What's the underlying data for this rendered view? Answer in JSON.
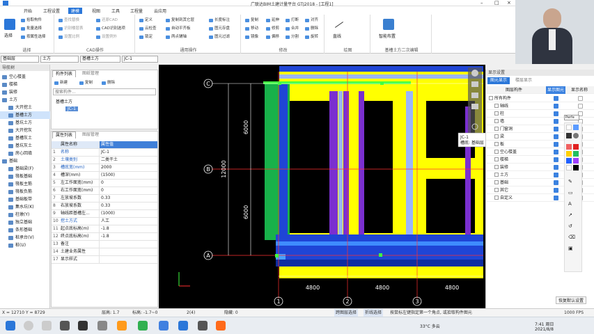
{
  "window": {
    "title": "广联达BIM土建计量平台 GTJ2018 - [工程1]"
  },
  "tabs": [
    "开始",
    "工程设置",
    "建模",
    "视图",
    "工具",
    "工程量",
    "云应用"
  ],
  "active_tab": "建模",
  "ribbon": {
    "select_group": {
      "label": "选择",
      "big": "选择",
      "items": [
        "拾取构件",
        "批量选择",
        "按属性选择"
      ]
    },
    "cad_group": {
      "label": "CAD操作",
      "items": [
        "查找替换",
        "识别楼层表",
        "CAD识别选项",
        "设置比例",
        "还原CAD",
        "设置例外"
      ]
    },
    "common_group": {
      "label": "通用操作",
      "items": [
        "定义",
        "云检查",
        "锁定",
        "复制到其它层",
        "自动平齐板",
        "两点辅轴",
        "长度标注",
        "图元存盘",
        "图元过滤"
      ]
    },
    "modify_group": {
      "label": "修改",
      "items": [
        "复制",
        "移动",
        "镜像",
        "延伸",
        "修剪",
        "偏移",
        "打断",
        "合并",
        "分割",
        "对齐",
        "删除",
        "旋转"
      ]
    },
    "draw_group": {
      "label": "绘图",
      "items": [
        "直线"
      ]
    },
    "smart_group": {
      "label": "基槽土方二次编辑",
      "items": [
        "智能布置"
      ]
    }
  },
  "selectors": [
    "基础层",
    "土方",
    "基槽土方",
    "JC-1"
  ],
  "nav": {
    "title": "导航树",
    "items": [
      "空心楼盖",
      "楼梯",
      "装修",
      "土方",
      "大开挖土",
      "基槽土方",
      "基坑土方",
      "大开挖灰",
      "基槽灰土",
      "基坑灰土",
      "房心回填",
      "基础",
      "基础梁(F)",
      "筏板基础",
      "筏板主筋",
      "筏板负筋",
      "基础板带",
      "集水坑(K)",
      "柱墩(Y)",
      "独立基础",
      "条形基础",
      "桩承台(V)",
      "桩(U)"
    ]
  },
  "component_list": {
    "tabs": [
      "构件列表",
      "图纸管理"
    ],
    "buttons": [
      "新建",
      "复制",
      "删除"
    ],
    "search_placeholder": "搜索构件...",
    "tree_root": "基槽土方",
    "tree_child": "JC-1"
  },
  "properties": {
    "tabs": [
      "属性列表",
      "图层管理"
    ],
    "headers": [
      "属性名称",
      "属性值"
    ],
    "rows": [
      {
        "n": "1",
        "k": "名称",
        "v": "JC-1"
      },
      {
        "n": "2",
        "k": "土壤类别",
        "v": "二类干土"
      },
      {
        "n": "3",
        "k": "槽底宽(mm)",
        "v": "2000"
      },
      {
        "n": "4",
        "k": "槽深(mm)",
        "v": "(1500)"
      },
      {
        "n": "5",
        "k": "左工作面宽(mm)",
        "v": "0"
      },
      {
        "n": "6",
        "k": "右工作面宽(mm)",
        "v": "0"
      },
      {
        "n": "7",
        "k": "左放坡系数",
        "v": "0.33"
      },
      {
        "n": "8",
        "k": "右放坡系数",
        "v": "0.33"
      },
      {
        "n": "9",
        "k": "轴线距基槽左...",
        "v": "(1000)"
      },
      {
        "n": "10",
        "k": "挖土方式",
        "v": "人工"
      },
      {
        "n": "11",
        "k": "起点底标高(m)",
        "v": "-1.8"
      },
      {
        "n": "12",
        "k": "终点底标高(m)",
        "v": "-1.8"
      },
      {
        "n": "13",
        "k": "备注",
        "v": ""
      },
      {
        "n": "14",
        "k": "土建业务属性",
        "v": ""
      },
      {
        "n": "17",
        "k": "显示样式",
        "v": ""
      }
    ]
  },
  "canvas": {
    "axis_labels": [
      "C",
      "B",
      "A",
      "1",
      "2",
      "3"
    ],
    "dims_vertical": [
      "6000",
      "12000",
      "6000"
    ],
    "dims_horizontal": [
      "4800",
      "4800",
      "4800"
    ],
    "tooltip": [
      "JC-1",
      "槽底: 基础层"
    ]
  },
  "display_panel": {
    "title": "显示设置",
    "tabs": [
      "图元显示",
      "楼层显示"
    ],
    "headers": [
      "图层构件",
      "显示图元",
      "显示名称"
    ],
    "items": [
      {
        "name": "所有构件",
        "show": true,
        "name_on": false
      },
      {
        "name": "轴线",
        "show": true,
        "name_on": false
      },
      {
        "name": "柱",
        "show": true,
        "name_on": false
      },
      {
        "name": "墙",
        "show": true,
        "name_on": false
      },
      {
        "name": "门窗洞",
        "show": true,
        "name_on": false
      },
      {
        "name": "梁",
        "show": true,
        "name_on": false
      },
      {
        "name": "板",
        "show": true,
        "name_on": false
      },
      {
        "name": "空心楼盖",
        "show": true,
        "name_on": false
      },
      {
        "name": "楼梯",
        "show": true,
        "name_on": false
      },
      {
        "name": "装修",
        "show": true,
        "name_on": false
      },
      {
        "name": "土方",
        "show": true,
        "name_on": false
      },
      {
        "name": "基础",
        "show": true,
        "name_on": false
      },
      {
        "name": "其它",
        "show": true,
        "name_on": false
      },
      {
        "name": "自定义",
        "show": true,
        "name_on": false
      }
    ],
    "restore_button": "恢复默认设置",
    "perfect_label": "Perfe"
  },
  "status": {
    "coords": "X = 12710 Y = 8729",
    "floor_height": "层高: 1.7",
    "elevation": "标高: -1.7~0",
    "count": "2(4)",
    "hidden": "隐藏: 0",
    "span_select": "跨图层选择",
    "fold_select": "折线选择",
    "hint": "按鼠标左键指定第一个角点, 或拾取构件图元",
    "fps": "1000 FPS"
  },
  "taskbar": {
    "weather": "33°C 多云",
    "time": "7:41 周日",
    "date": "2021/8/8"
  },
  "colors": {
    "accent": "#2b77d9",
    "yellow": "#ffff00",
    "blue": "#1e4fd8",
    "green": "#17b34a",
    "purple": "#7a2fd0",
    "canvas_bg": "#000000"
  }
}
